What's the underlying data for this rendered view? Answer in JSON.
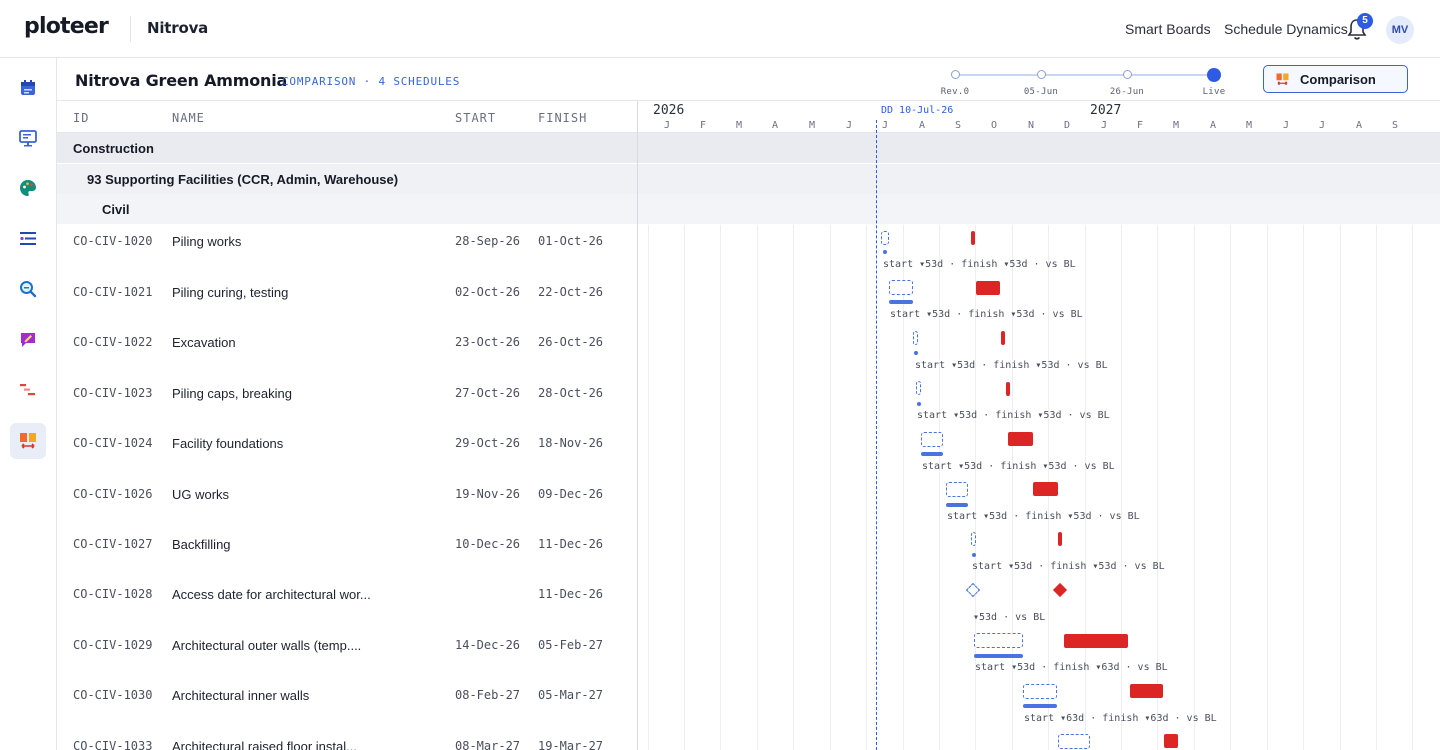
{
  "header": {
    "logo": "ploteer",
    "project": "Nitrova",
    "nav": [
      "Smart Boards",
      "Schedule Dynamics"
    ],
    "notification_count": "5",
    "avatar_initials": "MV"
  },
  "sidebar": {
    "items": [
      {
        "name": "calendar-icon"
      },
      {
        "name": "presentation-icon"
      },
      {
        "name": "palette-icon"
      },
      {
        "name": "list-icon"
      },
      {
        "name": "magnify-icon"
      },
      {
        "name": "edit-note-icon"
      },
      {
        "name": "gantt-icon"
      },
      {
        "name": "comparison-icon"
      }
    ]
  },
  "subheader": {
    "title": "Nitrova Green Ammonia",
    "subtitle": "COMPARISON · 4 SCHEDULES",
    "revisions": [
      "Rev.0",
      "05-Jun",
      "26-Jun",
      "Live"
    ],
    "comparison_button": "Comparison"
  },
  "table": {
    "columns": [
      "ID",
      "NAME",
      "START",
      "FINISH"
    ]
  },
  "timeline": {
    "years": [
      "2026",
      "2027"
    ],
    "months": [
      "J",
      "F",
      "M",
      "A",
      "M",
      "J",
      "J",
      "A",
      "S",
      "O",
      "N",
      "D",
      "J",
      "F",
      "M",
      "A",
      "M",
      "J",
      "J",
      "A",
      "S"
    ],
    "data_date_label": "DD 10-Jul-26"
  },
  "groups": [
    {
      "label": "Construction",
      "level": 0
    },
    {
      "label": "93 Supporting Facilities (CCR, Admin, Warehouse)",
      "level": 1
    },
    {
      "label": "Civil",
      "level": 2
    }
  ],
  "rows": [
    {
      "id": "CO-CIV-1020",
      "name": "Piling works",
      "start": "28-Sep-26",
      "finish": "01-Oct-26",
      "variance": "start ▾53d · finish ▾53d · vs BL"
    },
    {
      "id": "CO-CIV-1021",
      "name": "Piling curing, testing",
      "start": "02-Oct-26",
      "finish": "22-Oct-26",
      "variance": "start ▾53d · finish ▾53d · vs BL"
    },
    {
      "id": "CO-CIV-1022",
      "name": "Excavation",
      "start": "23-Oct-26",
      "finish": "26-Oct-26",
      "variance": "start ▾53d · finish ▾53d · vs BL"
    },
    {
      "id": "CO-CIV-1023",
      "name": "Piling caps, breaking",
      "start": "27-Oct-26",
      "finish": "28-Oct-26",
      "variance": "start ▾53d · finish ▾53d · vs BL"
    },
    {
      "id": "CO-CIV-1024",
      "name": "Facility foundations",
      "start": "29-Oct-26",
      "finish": "18-Nov-26",
      "variance": "start ▾53d · finish ▾53d · vs BL"
    },
    {
      "id": "CO-CIV-1026",
      "name": "UG works",
      "start": "19-Nov-26",
      "finish": "09-Dec-26",
      "variance": "start ▾53d · finish ▾53d · vs BL"
    },
    {
      "id": "CO-CIV-1027",
      "name": "Backfilling",
      "start": "10-Dec-26",
      "finish": "11-Dec-26",
      "variance": "start ▾53d · finish ▾53d · vs BL"
    },
    {
      "id": "CO-CIV-1028",
      "name": "Access date for architectural wor...",
      "start": "",
      "finish": "11-Dec-26",
      "variance": "▾53d · vs BL"
    },
    {
      "id": "CO-CIV-1029",
      "name": "Architectural outer walls (temp....",
      "start": "14-Dec-26",
      "finish": "05-Feb-27",
      "variance": "start ▾53d · finish ▾63d · vs BL"
    },
    {
      "id": "CO-CIV-1030",
      "name": "Architectural inner walls",
      "start": "08-Feb-27",
      "finish": "05-Mar-27",
      "variance": "start ▾63d · finish ▾63d · vs BL"
    },
    {
      "id": "CO-CIV-1033",
      "name": "Architectural raised floor instal...",
      "start": "08-Mar-27",
      "finish": "19-Mar-27",
      "variance": ""
    }
  ],
  "colors": {
    "accent": "#2d5be3",
    "baseline": "#4a72e0",
    "live": "#dc2626"
  }
}
